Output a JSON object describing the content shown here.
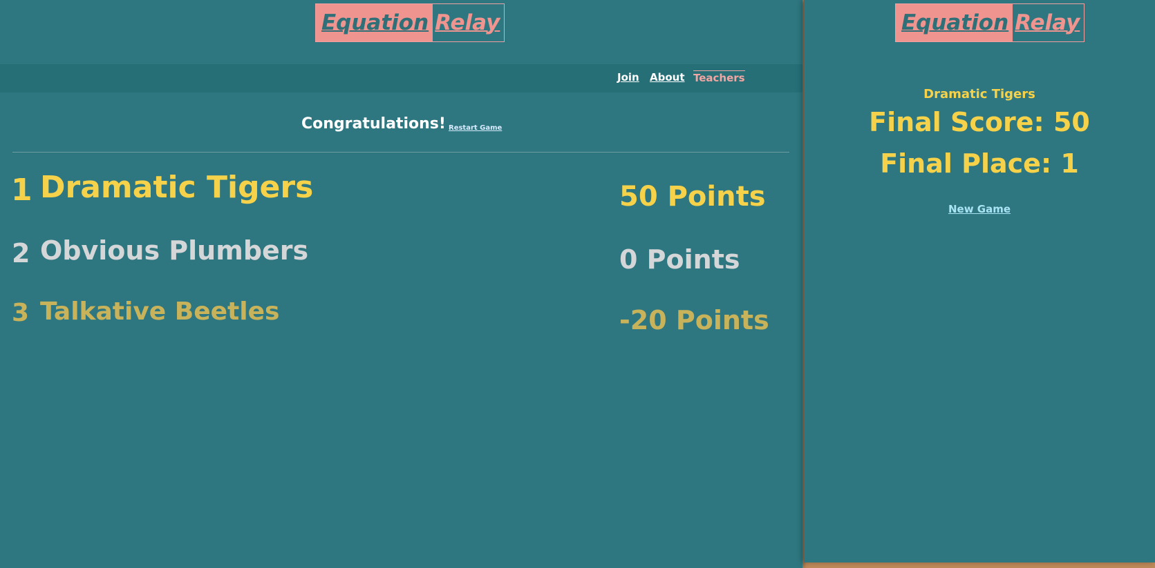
{
  "left": {
    "logo": {
      "part1": "Equation",
      "part2": "Relay"
    },
    "nav": {
      "join": "Join",
      "about": "About",
      "teachers": "Teachers"
    },
    "congrats": "Congratulations!",
    "restart": "Restart Game",
    "results": [
      {
        "rank": "1",
        "name": "Dramatic Tigers",
        "points": "50 Points"
      },
      {
        "rank": "2",
        "name": "Obvious Plumbers",
        "points": "0 Points"
      },
      {
        "rank": "3",
        "name": "Talkative Beetles",
        "points": "-20 Points"
      }
    ]
  },
  "right": {
    "logo": {
      "part1": "Equation",
      "part2": "Relay"
    },
    "team": "Dramatic Tigers",
    "final_score": "Final Score: 50",
    "final_place": "Final Place: 1",
    "new_game": "New Game"
  },
  "colors": {
    "background": "#2f7780",
    "gold": "#f6d24a",
    "silver": "#d4d6d8",
    "bronze": "#c9b35a",
    "logo_pink": "#f0948f"
  }
}
